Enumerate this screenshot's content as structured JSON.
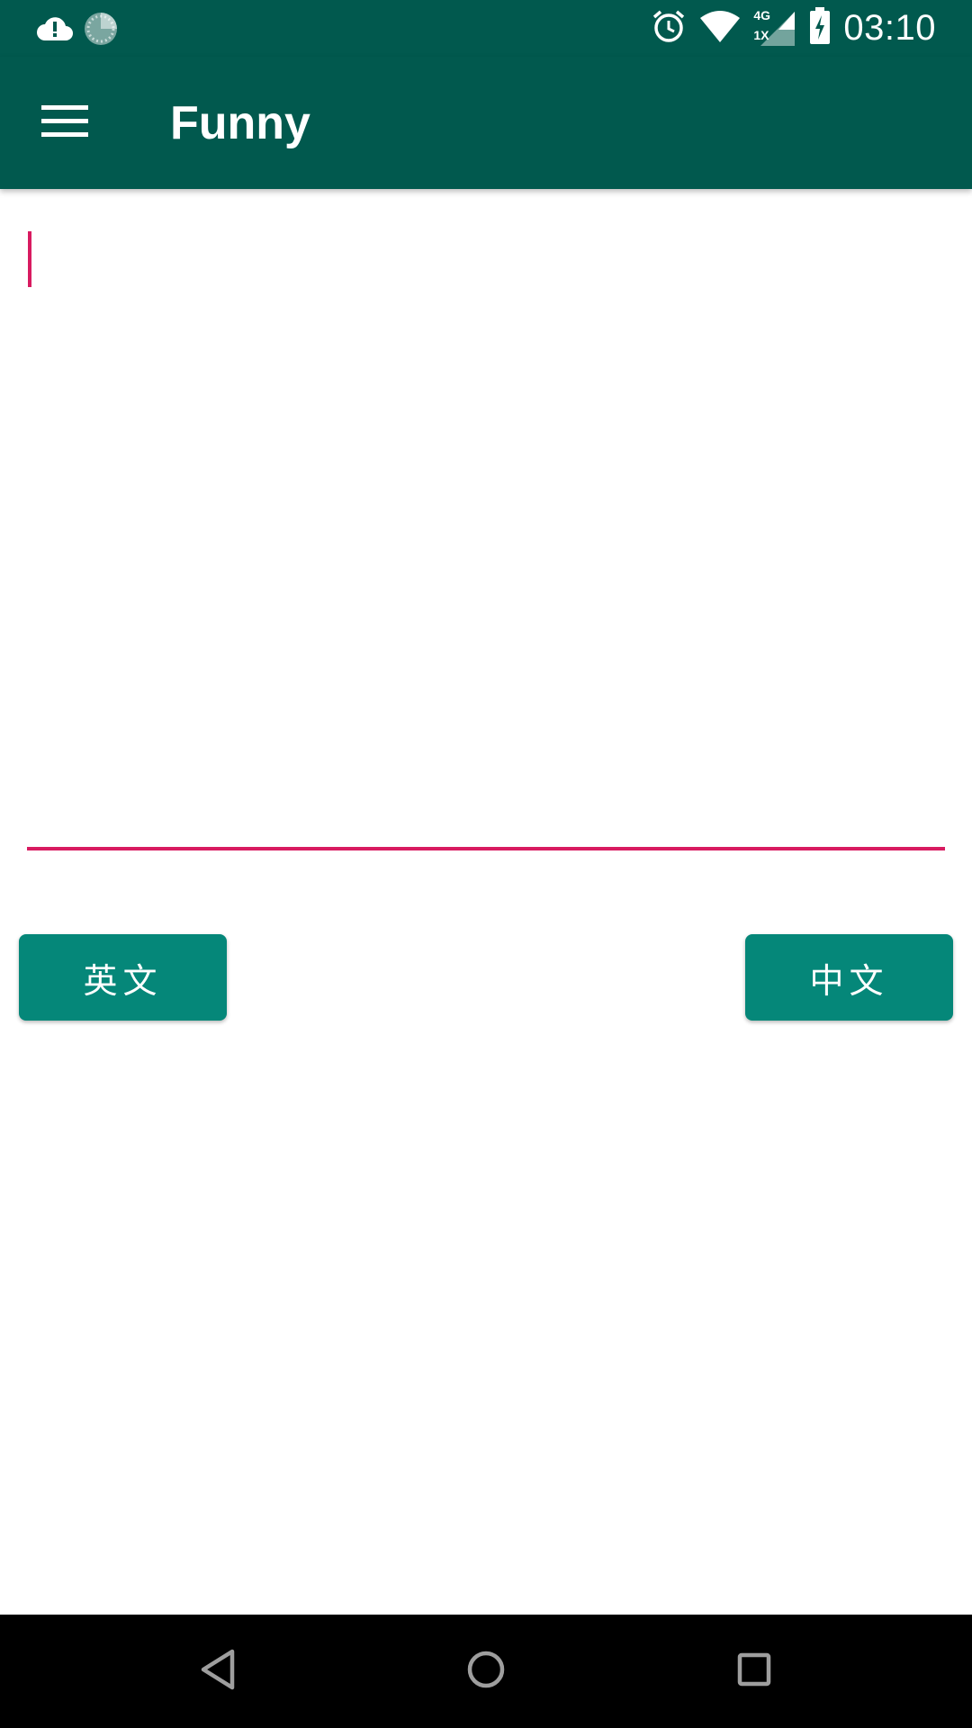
{
  "status_bar": {
    "time": "03:10",
    "network_type": "4G",
    "network_sub": "1X",
    "icons": [
      "cloud-alert-icon",
      "sync-loader-icon",
      "alarm-icon",
      "wifi-icon",
      "cell-signal-icon",
      "battery-charging-icon"
    ]
  },
  "app_bar": {
    "title": "Funny",
    "menu_icon": "hamburger-menu-icon"
  },
  "editor": {
    "value": "",
    "accent_color": "#d81b60"
  },
  "actions": {
    "english_label": "英文",
    "chinese_label": "中文"
  },
  "nav_bar": {
    "icons": [
      "back-icon",
      "home-icon",
      "recents-icon"
    ]
  },
  "colors": {
    "primary_dark": "#01594e",
    "button": "#058779",
    "accent": "#d81b60"
  }
}
